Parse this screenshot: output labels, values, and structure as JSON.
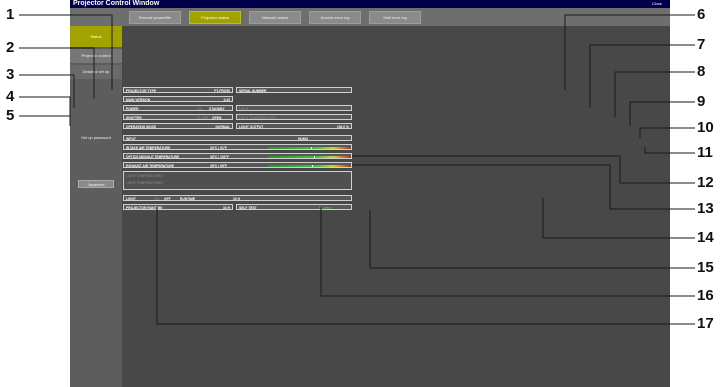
{
  "callout_labels": [
    "1",
    "2",
    "3",
    "4",
    "5",
    "6",
    "7",
    "8",
    "9",
    "10",
    "11",
    "12",
    "13",
    "14",
    "15",
    "16",
    "17"
  ],
  "window": {
    "title": "Projector Control Window",
    "close_label": "Close"
  },
  "tabs": [
    "Remote power/file",
    "Projector status",
    "Network status",
    "Access error log",
    "Mail error log"
  ],
  "sidebar": {
    "status": "Status",
    "control": "Projector control",
    "network": "Detailed set up",
    "password": "Set up password",
    "language": "Japanese"
  },
  "status": {
    "projector_type_label": "PROJECTOR TYPE",
    "projector_type": "PT-FRQ50",
    "serial_label": "SERIAL NUMBER",
    "main_version_label": "MAIN VERSION",
    "main_version": "0.23",
    "power_label": "POWER",
    "power_on": "ON",
    "power_standby": "STANDBY",
    "shutter_label": "SHUTTER",
    "shutter_close": "CLOSE",
    "shutter_open": "OPEN",
    "operating_mode_label": "OPERATING MODE",
    "operating_mode": "NORMAL",
    "light_output_label": "LIGHT OUTPUT",
    "light_output": "100.0 %",
    "input_label": "INPUT",
    "input": "HDMI1",
    "intake_label": "INTAKE AIR TEMPERATURE",
    "intake": "33°C / 91°F",
    "optics_label": "OPTICS MODULE TEMPERATURE",
    "optics": "38°C / 100°F",
    "exhaust_label": "EXHAUST AIR TEMPERATURE",
    "exhaust": "35°C / 95°F",
    "light_temp1_label": "LIGHT TEMPERATURE1",
    "light_temp2_label": "LIGHT TEMPERATURE2",
    "light_label": "LIGHT",
    "light_on": "ON",
    "light_off": "OFF",
    "runtime_label": "RUNTIME",
    "runtime": "33 H",
    "projector_runtime_label": "PROJECTOR RUNTIME",
    "projector_runtime": "33 H",
    "self_test_label": "SELF TEST",
    "self_test": "No error"
  }
}
